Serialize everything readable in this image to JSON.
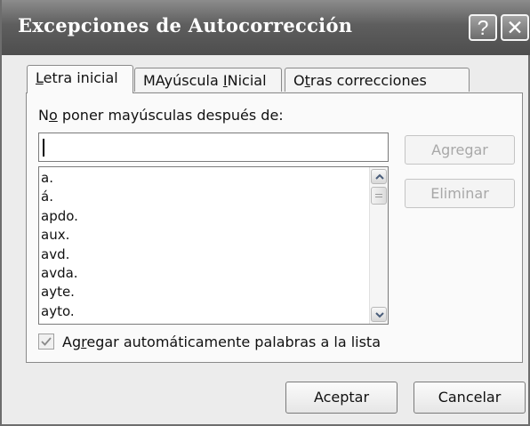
{
  "window": {
    "title": "Excepciones de Autocorrección",
    "help_glyph": "?",
    "close_glyph": "✕"
  },
  "tabs": [
    {
      "pre": "",
      "key": "L",
      "post": "etra inicial",
      "active": true
    },
    {
      "pre": "MAyúscula ",
      "key": "I",
      "post": "Nicial",
      "active": false
    },
    {
      "pre": "O",
      "key": "t",
      "post": "ras correcciones",
      "active": false
    }
  ],
  "panel": {
    "label_pre": "N",
    "label_key": "o",
    "label_post": " poner mayúsculas después de:",
    "input_value": "",
    "list_items": [
      "a.",
      "á.",
      "apdo.",
      "aux.",
      "avd.",
      "avda.",
      "ayte.",
      "ayto."
    ],
    "add_button": "Agregar",
    "delete_button": "Eliminar",
    "checkbox": {
      "checked": true,
      "label_pre": "Ag",
      "label_key": "r",
      "label_post": "egar automáticamente palabras a la lista"
    }
  },
  "footer": {
    "ok_button": "Aceptar",
    "cancel_button": "Cancelar"
  },
  "colors": {
    "titlebar": "#5e5e5e",
    "dialog_bg": "#ececec",
    "disabled_text": "#a8a8a8"
  },
  "icons": {
    "scroll_up": "chevron-up-icon",
    "scroll_down": "chevron-down-icon",
    "check": "checkmark-icon"
  }
}
